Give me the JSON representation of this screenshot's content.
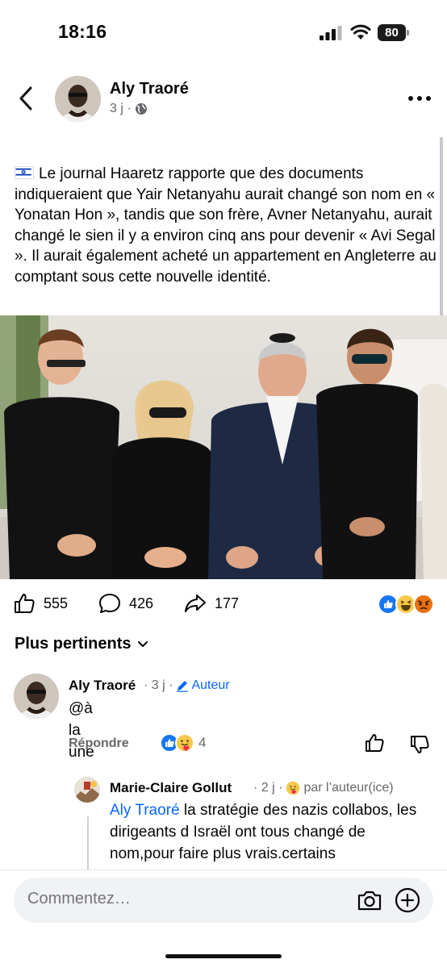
{
  "status_bar": {
    "time": "18:16",
    "battery": "80"
  },
  "post": {
    "author": "Aly Traoré",
    "meta": "3 j ·",
    "text": "Le journal Haaretz rapporte que des documents indiqueraient que Yair Netanyahu aurait changé son nom en « Yonatan Hon », tandis que son frère, Avner Netanyahu, aurait changé le sien il y a environ cinq ans pour devenir « Avi Segal ». Il aurait également acheté un appartement en Angleterre au comptant sous cette nouvelle identité.",
    "likes": "555",
    "comments": "426",
    "shares": "177"
  },
  "sort_label": "Plus pertinents",
  "comments": [
    {
      "author": "Aly Traoré",
      "meta": "· 3 j ·",
      "tag": "Auteur",
      "text": "@à la une",
      "reply_label": "Répondre",
      "reaction_count": "4"
    },
    {
      "author": "Marie-Claire Gollut",
      "meta": "· 2 j ·",
      "tag": "par l’auteur(ice)",
      "mention": "Aly Traoré",
      "text": " la stratégie des nazis collabos, les dirigeants d Israël ont tous changé de nom,pour faire plus vrais.certains"
    }
  ],
  "composer": {
    "placeholder": "Commentez…"
  },
  "colors": {
    "accent": "#0866ff",
    "muted": "#65676b",
    "like_blue": "#1877f2",
    "angry": "#e9710f"
  }
}
